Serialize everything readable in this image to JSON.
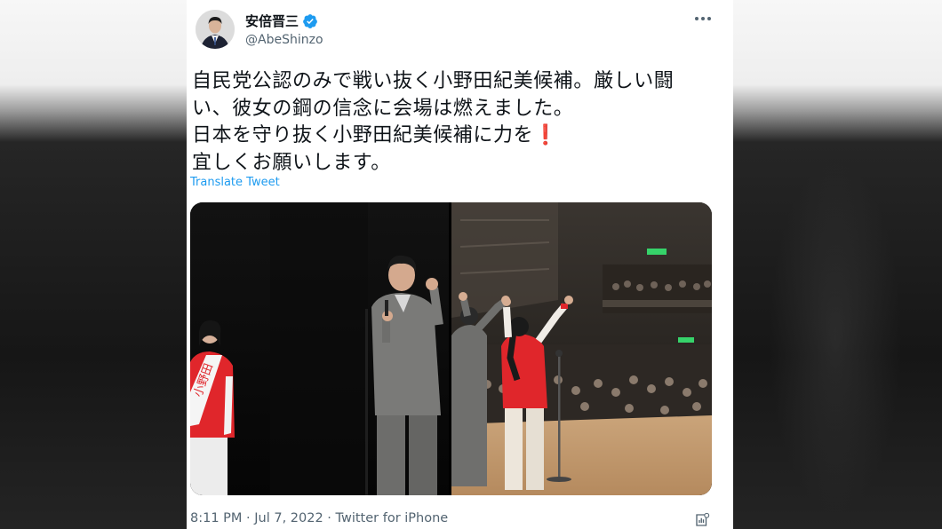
{
  "tweet": {
    "display_name": "安倍晋三",
    "handle": "@AbeShinzo",
    "verified_icon": "verified-badge-icon",
    "more_icon": "more-horizontal-icon",
    "text_lines": [
      "自民党公認のみで戦い抜く小野田紀美候補。厳しい闘",
      "い、彼女の鋼の信念に会場は燃えました。",
      "日本を守り抜く小野田紀美候補に力を",
      "宜しくお願いします。"
    ],
    "exclamation": "❗",
    "translate_label": "Translate Tweet",
    "timestamp": "8:11 PM · Jul 7, 2022 · Twitter for iPhone",
    "sash_text": "小野田"
  },
  "colors": {
    "link": "#1d9bf0",
    "verified": "#1d9bf0",
    "text": "#0f1419",
    "secondary": "#536471",
    "sash_red": "#e0262b"
  }
}
